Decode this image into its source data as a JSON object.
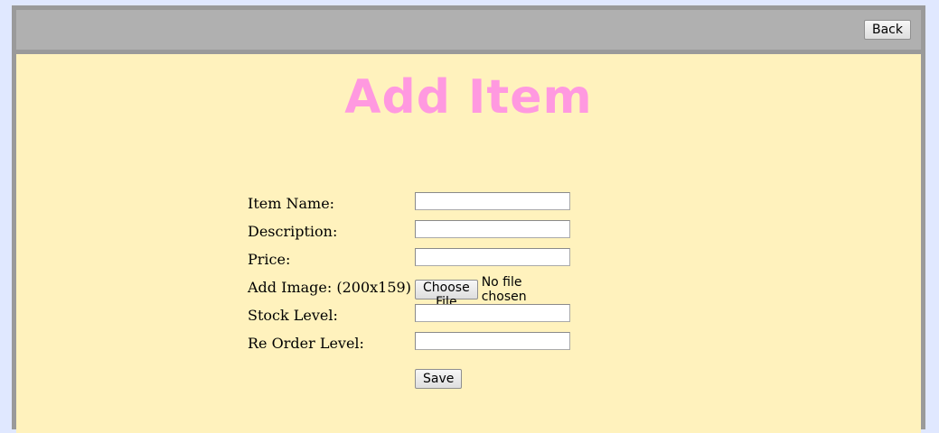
{
  "header": {
    "back_label": "Back"
  },
  "main": {
    "title": "Add Item",
    "title_color": "#ff99e0",
    "background_color": "#fff2bd"
  },
  "form": {
    "fields": [
      {
        "label": "Item Name:",
        "value": "",
        "placeholder": ""
      },
      {
        "label": "Description:",
        "value": "",
        "placeholder": ""
      },
      {
        "label": "Price:",
        "value": "",
        "placeholder": ""
      },
      {
        "label": "Add Image: (200x159)",
        "button_label": "Choose File",
        "status": "No file chosen"
      },
      {
        "label": "Stock Level:",
        "value": "",
        "placeholder": ""
      },
      {
        "label": "Re Order Level:",
        "value": "",
        "placeholder": ""
      }
    ],
    "save_label": "Save"
  }
}
